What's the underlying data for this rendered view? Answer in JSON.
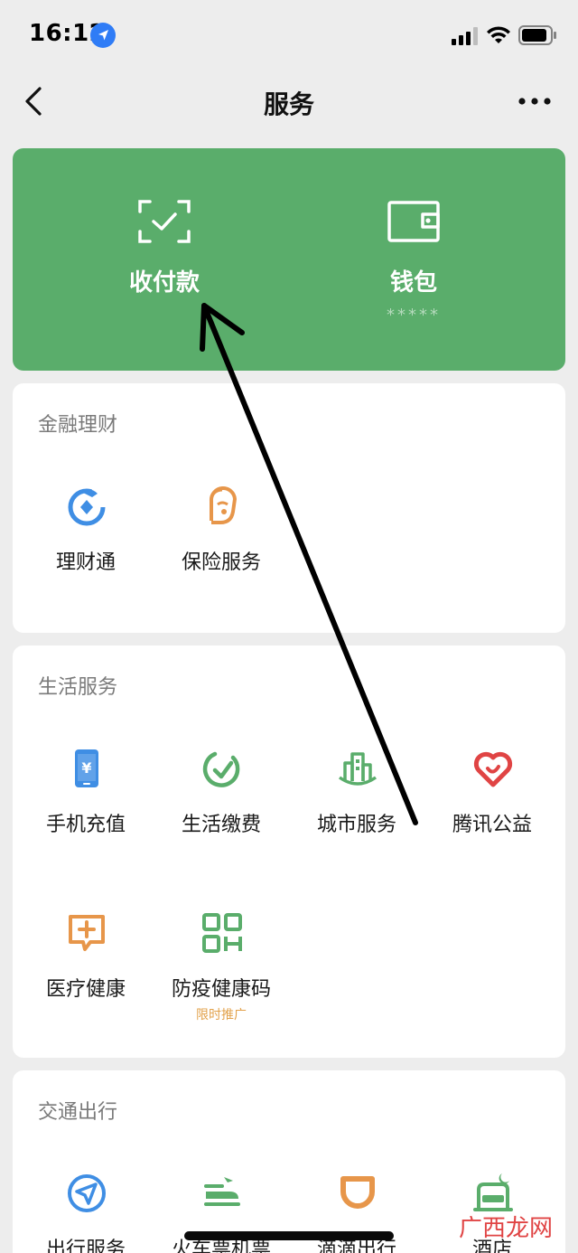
{
  "status": {
    "time": "16:12"
  },
  "nav": {
    "title": "服务"
  },
  "top": {
    "pay_label": "收付款",
    "wallet_label": "钱包",
    "wallet_balance": "*****"
  },
  "finance": {
    "title": "金融理财",
    "items": [
      {
        "label": "理财通",
        "icon": "wealth-icon",
        "color": "#3f8ee4"
      },
      {
        "label": "保险服务",
        "icon": "insurance-icon",
        "color": "#e7964a"
      }
    ]
  },
  "life": {
    "title": "生活服务",
    "items": [
      {
        "label": "手机充值",
        "icon": "phone-recharge-icon",
        "color": "#3f8ee4"
      },
      {
        "label": "生活缴费",
        "icon": "utility-payment-icon",
        "color": "#5aad6b"
      },
      {
        "label": "城市服务",
        "icon": "city-service-icon",
        "color": "#5aad6b"
      },
      {
        "label": "腾讯公益",
        "icon": "charity-heart-icon",
        "color": "#e04444"
      },
      {
        "label": "医疗健康",
        "icon": "medical-icon",
        "color": "#e7964a"
      },
      {
        "label": "防疫健康码",
        "tag": "限时推广",
        "icon": "health-code-icon",
        "color": "#5aad6b"
      }
    ]
  },
  "transport": {
    "title": "交通出行",
    "items": [
      {
        "label": "出行服务",
        "icon": "travel-navigation-icon",
        "color": "#3f8ee4"
      },
      {
        "label": "火车票机票",
        "icon": "train-ticket-icon",
        "color": "#5aad6b"
      },
      {
        "label": "滴滴出行",
        "icon": "didi-icon",
        "color": "#e7964a"
      },
      {
        "label": "酒店",
        "icon": "hotel-icon",
        "color": "#5aad6b"
      }
    ]
  },
  "watermark": "广西龙网"
}
